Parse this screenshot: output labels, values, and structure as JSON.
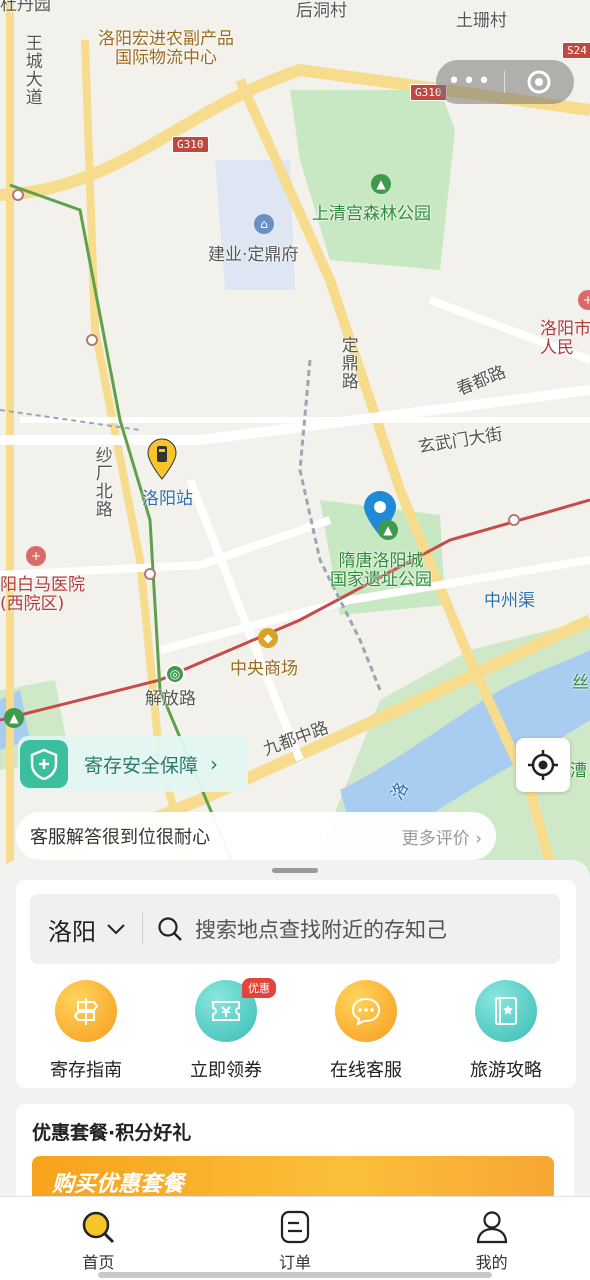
{
  "status_bar": {
    "left": "杜",
    "right": "土珊村"
  },
  "capsule": {
    "dots": "•••"
  },
  "map": {
    "labels": {
      "top_left": "杜丹园",
      "houdong": "后洞村",
      "logistics": "洛阳宏进农副产品\n国际物流中心",
      "wangcheng": "王城大道",
      "g310_top": "G310",
      "g310_mid": "G310",
      "s24": "S24",
      "shangqing": "上清宫森林公园",
      "jianye": "建业·定鼎府",
      "dingding": "定鼎路",
      "chundu": "春都路",
      "renmin": "洛阳市\n人民",
      "xuanwu": "玄武门大街",
      "shachang": "纱厂北路",
      "station": "洛阳站",
      "baima": "阳白马医院\n(西院区)",
      "suitang": "隋唐洛阳城\n国家遗址公园",
      "zhongzhou": "中州渠",
      "zhongyang": "中央商场",
      "jiefang": "解放路",
      "jiudu": "九都中路",
      "luo": "洛",
      "cao": "漕",
      "si": "丝"
    }
  },
  "safety": {
    "label": "寄存安全保障",
    "chevron": "›"
  },
  "review": {
    "message": "客服解答很到位很耐心",
    "more": "更多评价 ›"
  },
  "search": {
    "city": "洛阳",
    "placeholder": "搜索地点查找附近的存知己"
  },
  "quick_actions": [
    {
      "label": "寄存指南",
      "icon": "signpost-icon",
      "color": "#f8a828"
    },
    {
      "label": "立即领券",
      "icon": "ticket-icon",
      "color": "#41c7bf",
      "badge": "优惠"
    },
    {
      "label": "在线客服",
      "icon": "chat-icon",
      "color": "#f8a828"
    },
    {
      "label": "旅游攻略",
      "icon": "guidebook-icon",
      "color": "#41c7bf"
    }
  ],
  "promo": {
    "title": "优惠套餐·积分好礼",
    "banner": "购买优惠套餐"
  },
  "tabs": [
    {
      "label": "首页",
      "icon": "home-search-icon"
    },
    {
      "label": "订单",
      "icon": "order-icon"
    },
    {
      "label": "我的",
      "icon": "profile-icon"
    }
  ]
}
